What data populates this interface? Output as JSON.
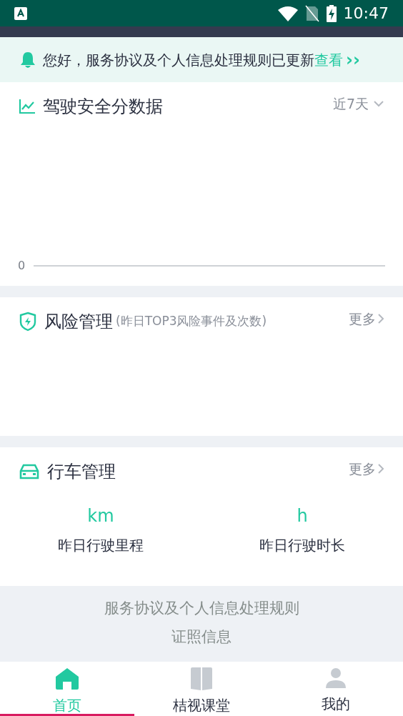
{
  "status_bar": {
    "time": "10:47"
  },
  "notice": {
    "text": "您好，服务协议及个人信息处理规则已更新",
    "link": "查看",
    "arrow": "››"
  },
  "score_card": {
    "title": "驾驶安全分数据",
    "range": "近7天",
    "axis_label": "0"
  },
  "risk_card": {
    "title": "风险管理",
    "subtitle": "(昨日TOP3风险事件及次数)",
    "more": "更多"
  },
  "trip_card": {
    "title": "行车管理",
    "more": "更多",
    "stats": [
      {
        "unit": "km",
        "label": "昨日行驶里程"
      },
      {
        "unit": "h",
        "label": "昨日行驶时长"
      }
    ]
  },
  "footer_links": [
    "服务协议及个人信息处理规则",
    "证照信息"
  ],
  "tabs": [
    {
      "label": "首页",
      "kind": "home",
      "selected": true
    },
    {
      "label": "桔视课堂",
      "kind": "book",
      "selected": false
    },
    {
      "label": "我的",
      "kind": "person",
      "selected": false
    }
  ]
}
